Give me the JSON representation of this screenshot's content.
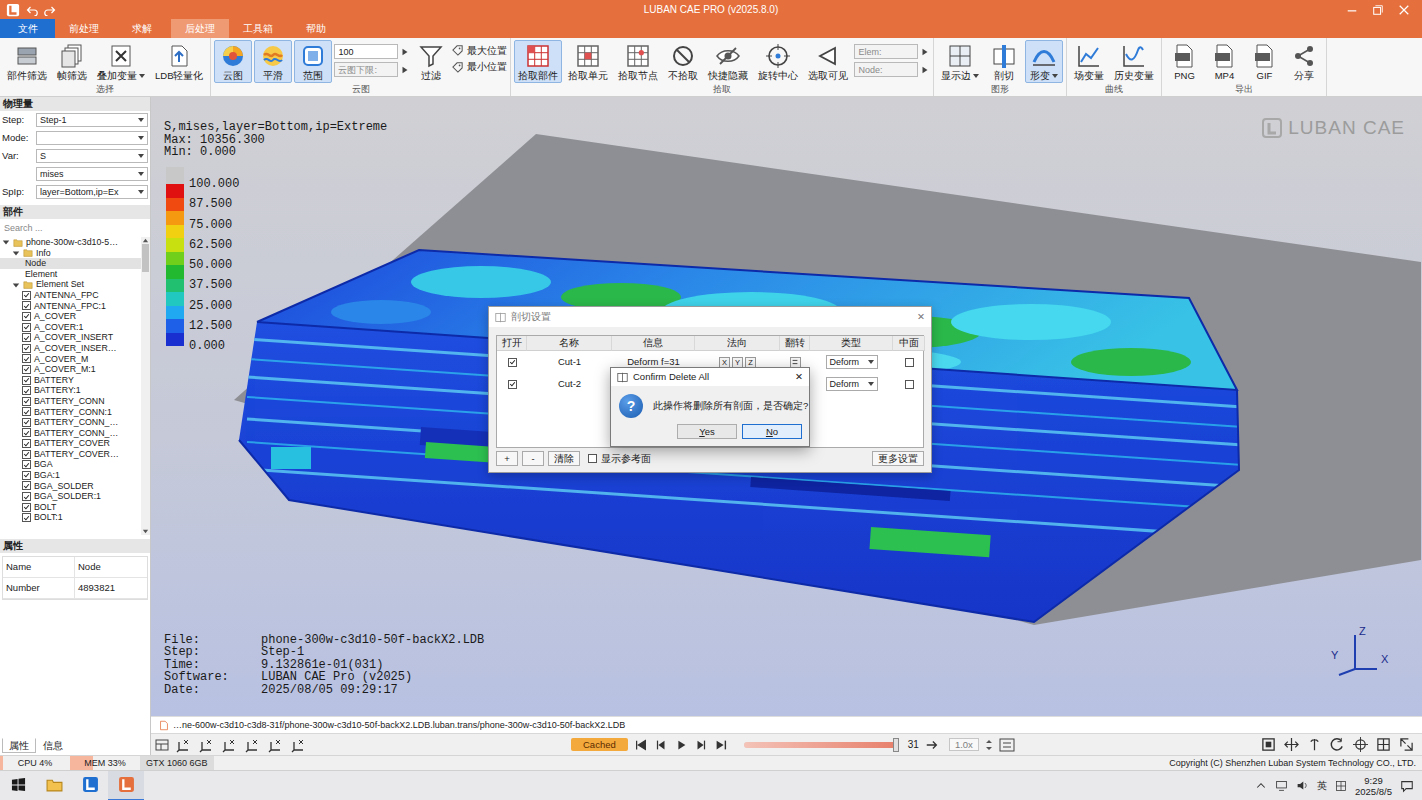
{
  "window": {
    "title": "LUBAN CAE PRO (v2025.8.0)"
  },
  "file_button": "文件",
  "menu_tabs": [
    {
      "label": "前处理",
      "selected": false
    },
    {
      "label": "求解",
      "selected": false
    },
    {
      "label": "后处理",
      "selected": true
    },
    {
      "label": "工具箱",
      "selected": false
    },
    {
      "label": "帮助",
      "selected": false
    }
  ],
  "ribbon": {
    "groups": [
      {
        "label": "选择",
        "items": [
          {
            "kind": "button",
            "label": "部件筛选",
            "selected": false,
            "dropdown": false
          },
          {
            "kind": "button",
            "label": "帧筛选",
            "selected": false,
            "dropdown": false
          },
          {
            "kind": "button",
            "label": "叠加变量",
            "selected": false,
            "dropdown": true
          },
          {
            "kind": "button",
            "label": "LDB轻量化",
            "selected": false,
            "dropdown": false
          }
        ]
      },
      {
        "label": "云图",
        "items": [
          {
            "kind": "button",
            "label": "云图",
            "selected": true,
            "dropdown": false
          },
          {
            "kind": "button",
            "label": "平滑",
            "selected": true,
            "dropdown": false
          },
          {
            "kind": "button",
            "label": "范围",
            "selected": true,
            "dropdown": false
          },
          {
            "kind": "fields",
            "fields": [
              {
                "value": "100",
                "disabled": false
              },
              {
                "placeholder": "云图下限:",
                "disabled": true
              }
            ]
          },
          {
            "kind": "button",
            "label": "过滤",
            "selected": false,
            "dropdown": false
          },
          {
            "kind": "tags",
            "tags": [
              "最大位置",
              "最小位置"
            ]
          }
        ]
      },
      {
        "label": "拾取",
        "items": [
          {
            "kind": "button",
            "label": "拾取部件",
            "selected": true,
            "dropdown": false
          },
          {
            "kind": "button",
            "label": "拾取单元",
            "selected": false,
            "dropdown": false
          },
          {
            "kind": "button",
            "label": "拾取节点",
            "selected": false,
            "dropdown": false
          },
          {
            "kind": "button",
            "label": "不拾取",
            "selected": false,
            "dropdown": false
          },
          {
            "kind": "button",
            "label": "快捷隐藏",
            "selected": false,
            "dropdown": false
          },
          {
            "kind": "button",
            "label": "旋转中心",
            "selected": false,
            "dropdown": false
          },
          {
            "kind": "button",
            "label": "选取可见",
            "selected": false,
            "dropdown": false
          },
          {
            "kind": "fields",
            "fields": [
              {
                "placeholder": "Elem:",
                "disabled": true
              },
              {
                "placeholder": "Node:",
                "disabled": true
              }
            ]
          }
        ]
      },
      {
        "label": "图形",
        "items": [
          {
            "kind": "button",
            "label": "显示边",
            "selected": false,
            "dropdown": true
          },
          {
            "kind": "button",
            "label": "剖切",
            "selected": false,
            "dropdown": false
          },
          {
            "kind": "button",
            "label": "形变",
            "selected": true,
            "dropdown": true
          }
        ]
      },
      {
        "label": "曲线",
        "items": [
          {
            "kind": "button",
            "label": "场变量",
            "selected": false,
            "dropdown": false
          },
          {
            "kind": "button",
            "label": "历史变量",
            "selected": false,
            "dropdown": false
          }
        ]
      },
      {
        "label": "导出",
        "items": [
          {
            "kind": "button",
            "label": "PNG",
            "selected": false,
            "dropdown": false
          },
          {
            "kind": "button",
            "label": "MP4",
            "selected": false,
            "dropdown": false
          },
          {
            "kind": "button",
            "label": "GIF",
            "selected": false,
            "dropdown": false
          },
          {
            "kind": "button",
            "label": "分享",
            "selected": false,
            "dropdown": false
          }
        ]
      }
    ]
  },
  "physics": {
    "title": "物理量",
    "rows": [
      {
        "label": "Step:",
        "value": "Step-1"
      },
      {
        "label": "Mode:",
        "value": ""
      },
      {
        "label": "Var:",
        "value": "S"
      },
      {
        "label": "",
        "value": "mises"
      },
      {
        "label": "SpIp:",
        "value": "layer=Bottom,ip=Ex"
      }
    ]
  },
  "parts": {
    "title": "部件",
    "search_placeholder": "Search ...",
    "scrollbar": {
      "level": 0.1
    },
    "tree": [
      {
        "kind": "folder",
        "label": "phone-300w-c3d10-5…",
        "depth": 0,
        "expanded": true,
        "selected": false
      },
      {
        "kind": "folder",
        "label": "Info",
        "depth": 1,
        "expanded": true,
        "selected": false
      },
      {
        "kind": "leaf",
        "label": "Node",
        "depth": 2,
        "selected": true
      },
      {
        "kind": "leaf",
        "label": "Element",
        "depth": 2,
        "selected": false
      },
      {
        "kind": "folder",
        "label": "Element Set",
        "depth": 1,
        "expanded": true,
        "selected": false
      },
      {
        "kind": "check",
        "label": "ANTENNA_FPC",
        "depth": 2,
        "checked": true,
        "selected": false
      },
      {
        "kind": "check",
        "label": "ANTENNA_FPC:1",
        "depth": 2,
        "checked": true,
        "selected": false
      },
      {
        "kind": "check",
        "label": "A_COVER",
        "depth": 2,
        "checked": true,
        "selected": false
      },
      {
        "kind": "check",
        "label": "A_COVER:1",
        "depth": 2,
        "checked": true,
        "selected": false
      },
      {
        "kind": "check",
        "label": "A_COVER_INSERT",
        "depth": 2,
        "checked": true,
        "selected": false
      },
      {
        "kind": "check",
        "label": "A_COVER_INSER…",
        "depth": 2,
        "checked": true,
        "selected": false
      },
      {
        "kind": "check",
        "label": "A_COVER_M",
        "depth": 2,
        "checked": true,
        "selected": false
      },
      {
        "kind": "check",
        "label": "A_COVER_M:1",
        "depth": 2,
        "checked": true,
        "selected": false
      },
      {
        "kind": "check",
        "label": "BATTERY",
        "depth": 2,
        "checked": true,
        "selected": false
      },
      {
        "kind": "check",
        "label": "BATTERY:1",
        "depth": 2,
        "checked": true,
        "selected": false
      },
      {
        "kind": "check",
        "label": "BATTERY_CONN",
        "depth": 2,
        "checked": true,
        "selected": false
      },
      {
        "kind": "check",
        "label": "BATTERY_CONN:1",
        "depth": 2,
        "checked": true,
        "selected": false
      },
      {
        "kind": "check",
        "label": "BATTERY_CONN_…",
        "depth": 2,
        "checked": true,
        "selected": false
      },
      {
        "kind": "check",
        "label": "BATTERY_CONN_…",
        "depth": 2,
        "checked": true,
        "selected": false
      },
      {
        "kind": "check",
        "label": "BATTERY_COVER",
        "depth": 2,
        "checked": true,
        "selected": false
      },
      {
        "kind": "check",
        "label": "BATTERY_COVER…",
        "depth": 2,
        "checked": true,
        "selected": false
      },
      {
        "kind": "check",
        "label": "BGA",
        "depth": 2,
        "checked": true,
        "selected": false
      },
      {
        "kind": "check",
        "label": "BGA:1",
        "depth": 2,
        "checked": true,
        "selected": false
      },
      {
        "kind": "check",
        "label": "BGA_SOLDER",
        "depth": 2,
        "checked": true,
        "selected": false
      },
      {
        "kind": "check",
        "label": "BGA_SOLDER:1",
        "depth": 2,
        "checked": true,
        "selected": false
      },
      {
        "kind": "check",
        "label": "BOLT",
        "depth": 2,
        "checked": true,
        "selected": false
      },
      {
        "kind": "check",
        "label": "BOLT:1",
        "depth": 2,
        "checked": true,
        "selected": false
      }
    ]
  },
  "properties": {
    "title": "属性",
    "rows": [
      {
        "name": "Name",
        "value": "Node"
      },
      {
        "name": "Number",
        "value": "4893821"
      }
    ]
  },
  "left_tabs": [
    {
      "label": "属性",
      "selected": true
    },
    {
      "label": "信息",
      "selected": false
    }
  ],
  "viewport": {
    "header": [
      "S,mises,layer=Bottom,ip=Extreme",
      "Max: 10356.300",
      "Min: 0.000"
    ],
    "legend": {
      "bands": [
        {
          "color": "#c8c8c8"
        },
        {
          "color": "#e01010"
        },
        {
          "color": "#f04a10"
        },
        {
          "color": "#f59a10"
        },
        {
          "color": "#f0d010"
        },
        {
          "color": "#c8e010"
        },
        {
          "color": "#6fcf1a"
        },
        {
          "color": "#22b830"
        },
        {
          "color": "#20c070"
        },
        {
          "color": "#20c8c0"
        },
        {
          "color": "#20a8f0"
        },
        {
          "color": "#1f60e8"
        },
        {
          "color": "#1a2fd0"
        }
      ],
      "labels": [
        "100.000",
        "87.500",
        "75.000",
        "62.500",
        "50.000",
        "37.500",
        "25.000",
        "12.500",
        "0.000"
      ]
    },
    "watermark": "LUBAN CAE",
    "info": [
      {
        "key": "File:",
        "value": "phone-300w-c3d10-50f-backX2.LDB"
      },
      {
        "key": "Step:",
        "value": "Step-1"
      },
      {
        "key": "Time:",
        "value": "9.132861e-01(031)"
      },
      {
        "key": "Software:",
        "value": "LUBAN CAE Pro (v2025)"
      },
      {
        "key": "Date:",
        "value": "2025/08/05 09:29:17"
      }
    ],
    "axes": {
      "z": "Z",
      "y": "Y",
      "x": "X"
    }
  },
  "cut_dialog": {
    "title": "剖切设置",
    "close": "✕",
    "columns": [
      "打开",
      "名称",
      "信息",
      "法向",
      "翻转",
      "类型",
      "中面"
    ],
    "rows": [
      {
        "open": true,
        "name": "Cut-1",
        "info": "Deform f=31",
        "normals": [
          "X",
          "Y",
          "Z"
        ],
        "flip": false,
        "type": "Deform",
        "mid": false,
        "selected": false
      },
      {
        "open": true,
        "name": "Cut-2",
        "type": "Deform",
        "mid": false,
        "selected": false
      }
    ],
    "buttons": [
      "+",
      "-",
      "清除"
    ],
    "ref_plane": {
      "label": "显示参考面",
      "checked": false
    },
    "more": "更多设置"
  },
  "confirm": {
    "title": "Confirm Delete All",
    "close": "✕",
    "icon": "?",
    "message": "此操作将删除所有剖面，是否确定?",
    "buttons": [
      {
        "label": "Yes",
        "selected": false
      },
      {
        "label": "No",
        "selected": true
      }
    ]
  },
  "path_bar": "…ne-600w-c3d10-c3d8-31f/phone-300w-c3d10-50f-backX2.LDB.luban.trans/phone-300w-c3d10-50f-backX2.LDB",
  "playback": {
    "cached": "Cached",
    "level": 1,
    "frame": "31",
    "speed": "1.0x"
  },
  "status_bar": {
    "meters": [
      {
        "label": "CPU 4%",
        "level": 0.04
      },
      {
        "label": "MEM 33%",
        "level": 0.33
      }
    ],
    "gpu": "GTX 1060 6GB",
    "copyright": "Copyright (C) Shenzhen Luban System Technology CO., LTD."
  },
  "taskbar": {
    "apps": [
      {
        "selected": false
      },
      {
        "selected": false
      },
      {
        "selected": true
      }
    ],
    "ime": "英",
    "time": "9:29",
    "date": "2025/8/5"
  }
}
